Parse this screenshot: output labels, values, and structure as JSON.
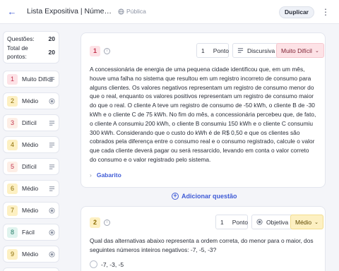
{
  "header": {
    "title": "Lista Expositiva | Números ...",
    "visibility": "Pública",
    "duplicate_label": "Duplicar"
  },
  "summary": {
    "questions_label": "Questões:",
    "questions_value": "20",
    "points_label": "Total de pontos:",
    "points_value": "20"
  },
  "nav": [
    {
      "num": "1",
      "label": "Muito Difícil",
      "icon": "text-lines-icon"
    },
    {
      "num": "2",
      "label": "Médio",
      "icon": "radio-dot-icon"
    },
    {
      "num": "3",
      "label": "Difícil",
      "icon": "text-lines-icon"
    },
    {
      "num": "4",
      "label": "Médio",
      "icon": "text-lines-icon"
    },
    {
      "num": "5",
      "label": "Difícil",
      "icon": "text-lines-icon"
    },
    {
      "num": "6",
      "label": "Médio",
      "icon": "text-lines-icon"
    },
    {
      "num": "7",
      "label": "Médio",
      "icon": "radio-dot-icon"
    },
    {
      "num": "8",
      "label": "Fácil",
      "icon": "radio-dot-icon"
    },
    {
      "num": "9",
      "label": "Médio",
      "icon": "radio-dot-icon"
    }
  ],
  "q1": {
    "num": "1",
    "points": "1",
    "points_label": "Ponto",
    "type": "Discursiva",
    "level": "Muito Difícil",
    "statement": "A concessionária de energia de uma pequena cidade identificou que, em um mês, houve uma falha no sistema que resultou em um registro incorreto de consumo para alguns clientes. Os valores negativos representam um registro de consumo menor do que o real, enquanto os valores positivos representam um registro de consumo maior do que o real. O cliente A teve um registro de consumo de -50 kWh, o cliente B de -30 kWh e o cliente C de 75 kWh. No fim do mês, a concessionária percebeu que, de fato, o cliente A consumiu 200 kWh, o cliente B consumiu 150 kWh e o cliente C consumiu 300 kWh. Considerando que o custo do kWh é de R$ 0,50 e que os clientes são cobrados pela diferença entre o consumo real e o consumo registrado, calcule o valor que cada cliente deverá pagar ou será ressarcido, levando em conta o valor correto do consumo e o valor registrado pelo sistema.",
    "gabarito": "Gabarito"
  },
  "add_question": "Adicionar questão",
  "q2": {
    "num": "2",
    "points": "1",
    "points_label": "Ponto",
    "type": "Objetiva",
    "level": "Médio",
    "statement": "Qual das alternativas abaixo representa a ordem correta, do menor para o maior, dos seguintes números inteiros negativos: -7, -5, -3?",
    "option_a": "-7, -3, -5"
  },
  "colors": {
    "accent": "#3f5bd6",
    "very_hard_badge_bg": "#fde2e6",
    "very_hard_badge_fg": "#c2334d",
    "medium_badge_bg": "#fdf0c2",
    "medium_badge_fg": "#8a6a00",
    "hard_badge_bg": "#fdeee6",
    "easy_badge_bg": "#dff3ee"
  }
}
